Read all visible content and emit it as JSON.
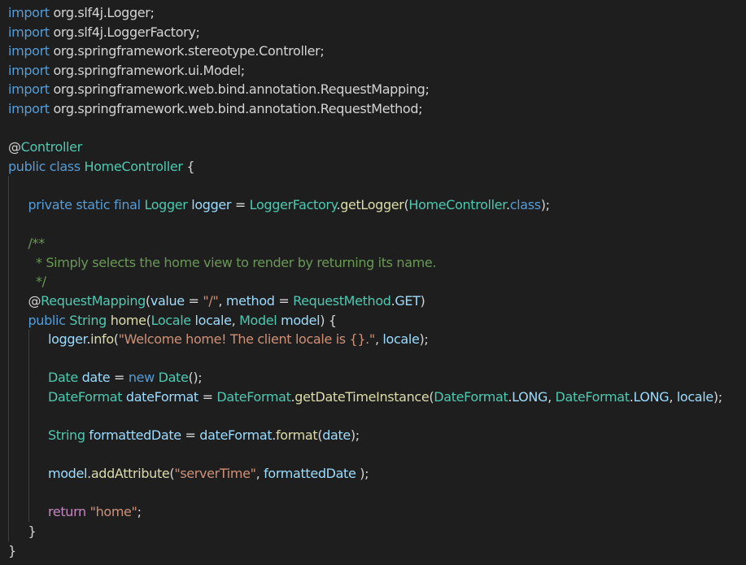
{
  "colors": {
    "background": "#1e1e1e",
    "keyword": "#569cd6",
    "control": "#c586c0",
    "type": "#4ec9b0",
    "variable": "#9cdcfe",
    "function": "#dcdcaa",
    "string": "#ce9178",
    "comment": "#6a9955",
    "text": "#d4d4d4"
  },
  "lines": [
    {
      "indent": 0,
      "tokens": [
        [
          "kw",
          "import"
        ],
        [
          "pl",
          " org.slf4j.Logger;"
        ]
      ]
    },
    {
      "indent": 0,
      "tokens": [
        [
          "kw",
          "import"
        ],
        [
          "pl",
          " org.slf4j.LoggerFactory;"
        ]
      ]
    },
    {
      "indent": 0,
      "tokens": [
        [
          "kw",
          "import"
        ],
        [
          "pl",
          " org.springframework.stereotype.Controller;"
        ]
      ]
    },
    {
      "indent": 0,
      "tokens": [
        [
          "kw",
          "import"
        ],
        [
          "pl",
          " org.springframework.ui.Model;"
        ]
      ]
    },
    {
      "indent": 0,
      "tokens": [
        [
          "kw",
          "import"
        ],
        [
          "pl",
          " org.springframework.web.bind.annotation.RequestMapping;"
        ]
      ]
    },
    {
      "indent": 0,
      "tokens": [
        [
          "kw",
          "import"
        ],
        [
          "pl",
          " org.springframework.web.bind.annotation.RequestMethod;"
        ]
      ]
    },
    {
      "indent": 0,
      "tokens": []
    },
    {
      "indent": 0,
      "tokens": [
        [
          "pl",
          "@"
        ],
        [
          "ty",
          "Controller"
        ]
      ]
    },
    {
      "indent": 0,
      "tokens": [
        [
          "kw",
          "public"
        ],
        [
          "pl",
          " "
        ],
        [
          "kw",
          "class"
        ],
        [
          "pl",
          " "
        ],
        [
          "ty",
          "HomeController"
        ],
        [
          "pl",
          " {"
        ]
      ]
    },
    {
      "indent": 1,
      "tokens": []
    },
    {
      "indent": 1,
      "tokens": [
        [
          "kw",
          "private"
        ],
        [
          "pl",
          " "
        ],
        [
          "kw",
          "static"
        ],
        [
          "pl",
          " "
        ],
        [
          "kw",
          "final"
        ],
        [
          "pl",
          " "
        ],
        [
          "ty",
          "Logger"
        ],
        [
          "pl",
          " "
        ],
        [
          "var",
          "logger"
        ],
        [
          "pl",
          " = "
        ],
        [
          "ty",
          "LoggerFactory"
        ],
        [
          "pl",
          "."
        ],
        [
          "fn",
          "getLogger"
        ],
        [
          "pl",
          "("
        ],
        [
          "ty",
          "HomeController"
        ],
        [
          "pl",
          "."
        ],
        [
          "kw",
          "class"
        ],
        [
          "pl",
          ");"
        ]
      ]
    },
    {
      "indent": 1,
      "tokens": []
    },
    {
      "indent": 1,
      "tokens": [
        [
          "cm",
          "/**"
        ]
      ]
    },
    {
      "indent": 1,
      "tokens": [
        [
          "cm",
          "  * Simply selects the home view to render by returning its name."
        ]
      ]
    },
    {
      "indent": 1,
      "tokens": [
        [
          "cm",
          "  */"
        ]
      ]
    },
    {
      "indent": 1,
      "tokens": [
        [
          "pl",
          "@"
        ],
        [
          "ty",
          "RequestMapping"
        ],
        [
          "pl",
          "("
        ],
        [
          "var",
          "value"
        ],
        [
          "pl",
          " = "
        ],
        [
          "str",
          "\"/\""
        ],
        [
          "pl",
          ", "
        ],
        [
          "var",
          "method"
        ],
        [
          "pl",
          " = "
        ],
        [
          "ty",
          "RequestMethod"
        ],
        [
          "pl",
          "."
        ],
        [
          "var",
          "GET"
        ],
        [
          "pl",
          ")"
        ]
      ]
    },
    {
      "indent": 1,
      "tokens": [
        [
          "kw",
          "public"
        ],
        [
          "pl",
          " "
        ],
        [
          "ty",
          "String"
        ],
        [
          "pl",
          " "
        ],
        [
          "fn",
          "home"
        ],
        [
          "pl",
          "("
        ],
        [
          "ty",
          "Locale"
        ],
        [
          "pl",
          " "
        ],
        [
          "var",
          "locale"
        ],
        [
          "pl",
          ", "
        ],
        [
          "ty",
          "Model"
        ],
        [
          "pl",
          " "
        ],
        [
          "var",
          "model"
        ],
        [
          "pl",
          ") {"
        ]
      ]
    },
    {
      "indent": 2,
      "tokens": [
        [
          "var",
          "logger"
        ],
        [
          "pl",
          "."
        ],
        [
          "fn",
          "info"
        ],
        [
          "pl",
          "("
        ],
        [
          "str",
          "\"Welcome home! The client locale is {}.\""
        ],
        [
          "pl",
          ", "
        ],
        [
          "var",
          "locale"
        ],
        [
          "pl",
          ");"
        ]
      ]
    },
    {
      "indent": 2,
      "tokens": []
    },
    {
      "indent": 2,
      "tokens": [
        [
          "ty",
          "Date"
        ],
        [
          "pl",
          " "
        ],
        [
          "var",
          "date"
        ],
        [
          "pl",
          " = "
        ],
        [
          "kw",
          "new"
        ],
        [
          "pl",
          " "
        ],
        [
          "ty",
          "Date"
        ],
        [
          "pl",
          "();"
        ]
      ]
    },
    {
      "indent": 2,
      "tokens": [
        [
          "ty",
          "DateFormat"
        ],
        [
          "pl",
          " "
        ],
        [
          "var",
          "dateFormat"
        ],
        [
          "pl",
          " = "
        ],
        [
          "ty",
          "DateFormat"
        ],
        [
          "pl",
          "."
        ],
        [
          "fn",
          "getDateTimeInstance"
        ],
        [
          "pl",
          "("
        ],
        [
          "ty",
          "DateFormat"
        ],
        [
          "pl",
          "."
        ],
        [
          "var",
          "LONG"
        ],
        [
          "pl",
          ", "
        ],
        [
          "ty",
          "DateFormat"
        ],
        [
          "pl",
          "."
        ],
        [
          "var",
          "LONG"
        ],
        [
          "pl",
          ", "
        ],
        [
          "var",
          "locale"
        ],
        [
          "pl",
          ");"
        ]
      ]
    },
    {
      "indent": 2,
      "tokens": []
    },
    {
      "indent": 2,
      "tokens": [
        [
          "ty",
          "String"
        ],
        [
          "pl",
          " "
        ],
        [
          "var",
          "formattedDate"
        ],
        [
          "pl",
          " = "
        ],
        [
          "var",
          "dateFormat"
        ],
        [
          "pl",
          "."
        ],
        [
          "fn",
          "format"
        ],
        [
          "pl",
          "("
        ],
        [
          "var",
          "date"
        ],
        [
          "pl",
          ");"
        ]
      ]
    },
    {
      "indent": 2,
      "tokens": []
    },
    {
      "indent": 2,
      "tokens": [
        [
          "var",
          "model"
        ],
        [
          "pl",
          "."
        ],
        [
          "fn",
          "addAttribute"
        ],
        [
          "pl",
          "("
        ],
        [
          "str",
          "\"serverTime\""
        ],
        [
          "pl",
          ", "
        ],
        [
          "var",
          "formattedDate"
        ],
        [
          "pl",
          " );"
        ]
      ]
    },
    {
      "indent": 2,
      "tokens": []
    },
    {
      "indent": 2,
      "tokens": [
        [
          "ctl",
          "return"
        ],
        [
          "pl",
          " "
        ],
        [
          "str",
          "\"home\""
        ],
        [
          "pl",
          ";"
        ]
      ]
    },
    {
      "indent": 1,
      "tokens": [
        [
          "pl",
          "}"
        ]
      ]
    },
    {
      "indent": 0,
      "tokens": [
        [
          "pl",
          "}"
        ]
      ]
    }
  ]
}
